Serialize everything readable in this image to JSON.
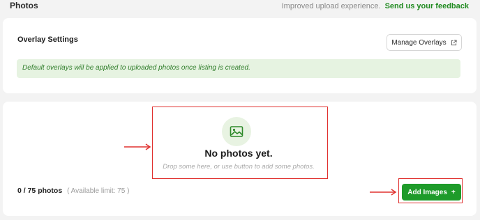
{
  "header": {
    "title": "Photos",
    "feedback_text": "Improved upload experience.",
    "feedback_link": "Send us your feedback"
  },
  "overlay": {
    "heading": "Overlay Settings",
    "manage_button": "Manage Overlays",
    "notice": "Default overlays will be applied to uploaded photos once listing is created."
  },
  "photos": {
    "empty_title": "No photos yet.",
    "empty_subtitle": "Drop some here, or use button to add some photos.",
    "count": "0 / 75 photos",
    "limit": "( Available limit: 75 )",
    "add_button": "Add Images",
    "add_button_icon": "+"
  },
  "colors": {
    "accent_green": "#1e9b2a",
    "notice_bg": "#e6f3e1",
    "annotation_red": "#e0312f"
  }
}
